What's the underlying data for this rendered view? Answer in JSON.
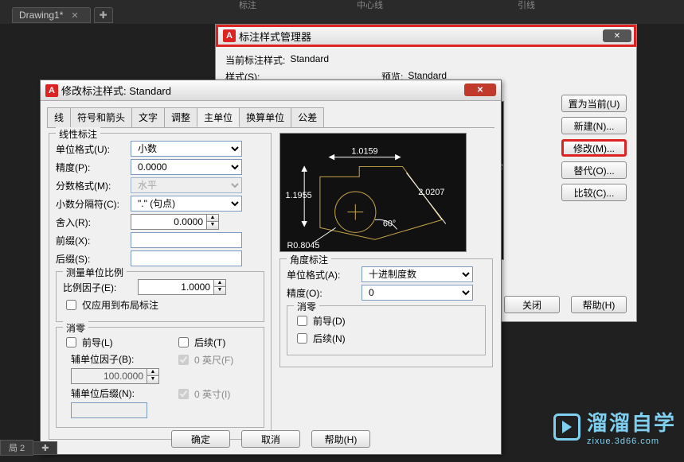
{
  "app": {
    "top_labels": {
      "l1": "标注",
      "l2": "中心线",
      "l3": "引线"
    },
    "tab_name": "Drawing1*",
    "bottom_tab": "局 2"
  },
  "dsm": {
    "title": "标注样式管理器",
    "current_label": "当前标注样式:",
    "current_value": "Standard",
    "styles_label": "样式(S):",
    "preview_label": "预览:",
    "preview_value": "Standard",
    "btn_setcur": "置为当前(U)",
    "btn_new": "新建(N)...",
    "btn_modify": "修改(M)...",
    "btn_override": "替代(O)...",
    "btn_compare": "比较(C)...",
    "btn_close": "关闭",
    "btn_help": "帮助(H)",
    "preview_dim": "2.0207"
  },
  "mds": {
    "title": "修改标注样式: Standard",
    "tabs": [
      "线",
      "符号和箭头",
      "文字",
      "调整",
      "主单位",
      "换算单位",
      "公差"
    ],
    "active_tab_idx": 4,
    "btn_ok": "确定",
    "btn_cancel": "取消",
    "btn_help": "帮助(H)",
    "left": {
      "grp_linear": "线性标注",
      "unit_format_lbl": "单位格式(U):",
      "unit_format_val": "小数",
      "precision_lbl": "精度(P):",
      "precision_val": "0.0000",
      "frac_lbl": "分数格式(M):",
      "frac_val": "水平",
      "decsep_lbl": "小数分隔符(C):",
      "decsep_val": "\".\" (句点)",
      "round_lbl": "舍入(R):",
      "round_val": "0.0000",
      "prefix_lbl": "前缀(X):",
      "prefix_val": "",
      "suffix_lbl": "后缀(S):",
      "suffix_val": "",
      "grp_scale": "测量单位比例",
      "scale_lbl": "比例因子(E):",
      "scale_val": "1.0000",
      "scale_chk": "仅应用到布局标注",
      "grp_zero": "消零",
      "lead_chk": "前导(L)",
      "trail_chk": "后续(T)",
      "subfactor_lbl": "辅单位因子(B):",
      "subfactor_val": "100.0000",
      "feet_chk": "0 英尺(F)",
      "subsuffix_lbl": "辅单位后缀(N):",
      "subsuffix_val": "",
      "inch_chk": "0 英寸(I)"
    },
    "right": {
      "preview": {
        "w": "1.0159",
        "h": "1.1955",
        "diag": "2.0207",
        "ang": "60°",
        "r": "R0.8045"
      },
      "grp_ang": "角度标注",
      "ang_unit_lbl": "单位格式(A):",
      "ang_unit_val": "十进制度数",
      "ang_prec_lbl": "精度(O):",
      "ang_prec_val": "0",
      "grp_zero": "消零",
      "ang_lead": "前导(D)",
      "ang_trail": "后续(N)"
    }
  },
  "wm": {
    "brand": "溜溜自学",
    "url": "zixue.3d66.com"
  }
}
